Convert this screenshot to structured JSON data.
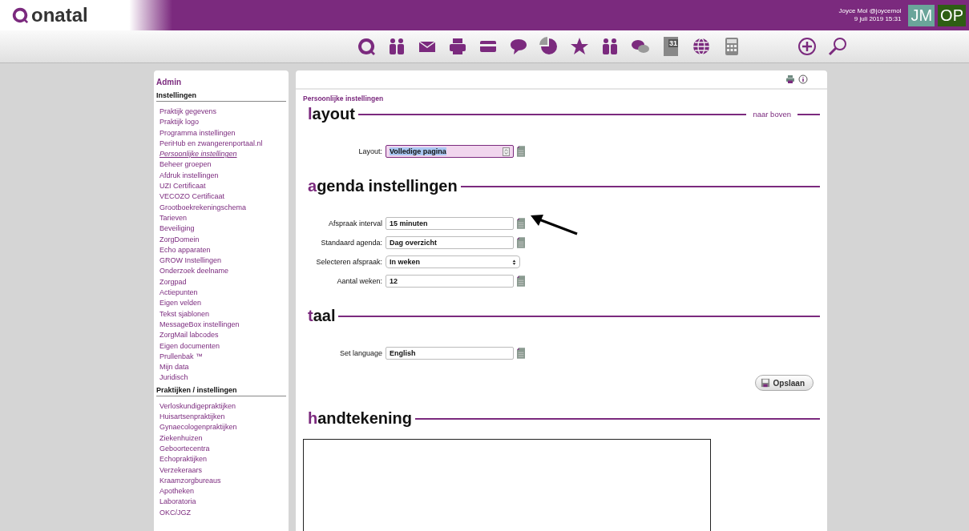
{
  "header": {
    "logo": "onatal",
    "user": "Joyce Mol @joycemol",
    "datetime": "9 juli 2019 15:31",
    "avatars": [
      {
        "initials": "JM",
        "color": "#6aa59a"
      },
      {
        "initials": "OP",
        "color": "#2e5e14"
      }
    ]
  },
  "toolbar": {
    "calendar_day": "31"
  },
  "sidebar": {
    "title": "Admin",
    "sections": [
      {
        "heading": "Instellingen",
        "items": [
          {
            "label": "Praktijk gegevens",
            "selected": false
          },
          {
            "label": "Praktijk logo",
            "selected": false
          },
          {
            "label": "Programma instellingen",
            "selected": false
          },
          {
            "label": "PeriHub en zwangerenportaal.nl",
            "selected": false
          },
          {
            "label": "Persoonlijke instellingen",
            "selected": true
          },
          {
            "label": "Beheer groepen",
            "selected": false
          },
          {
            "label": "Afdruk instellingen",
            "selected": false
          },
          {
            "label": "UZI Certificaat",
            "selected": false
          },
          {
            "label": "VECOZO Certificaat",
            "selected": false
          },
          {
            "label": "Grootboekrekeningschema",
            "selected": false
          },
          {
            "label": "Tarieven",
            "selected": false
          },
          {
            "label": "Beveiliging",
            "selected": false
          },
          {
            "label": "ZorgDomein",
            "selected": false
          },
          {
            "label": "Echo apparaten",
            "selected": false
          },
          {
            "label": "GROW Instellingen",
            "selected": false
          },
          {
            "label": "Onderzoek deelname",
            "selected": false
          },
          {
            "label": "Zorgpad",
            "selected": false
          },
          {
            "label": "Actiepunten",
            "selected": false
          },
          {
            "label": "Eigen velden",
            "selected": false
          },
          {
            "label": "Tekst sjablonen",
            "selected": false
          },
          {
            "label": "MessageBox instellingen",
            "selected": false
          },
          {
            "label": "ZorgMail labcodes",
            "selected": false
          },
          {
            "label": "Eigen documenten",
            "selected": false
          },
          {
            "label": "Prullenbak ™",
            "selected": false
          },
          {
            "label": "Mijn data",
            "selected": false
          },
          {
            "label": "Juridisch",
            "selected": false
          }
        ]
      },
      {
        "heading": "Praktijken / instellingen",
        "items": [
          {
            "label": "Verloskundigepraktijken",
            "selected": false
          },
          {
            "label": "Huisartsenpraktijken",
            "selected": false
          },
          {
            "label": "Gynaecologenpraktijken",
            "selected": false
          },
          {
            "label": "Ziekenhuizen",
            "selected": false
          },
          {
            "label": "Geboortecentra",
            "selected": false
          },
          {
            "label": "Echopraktijken",
            "selected": false
          },
          {
            "label": "Verzekeraars",
            "selected": false
          },
          {
            "label": "Kraamzorgbureaus",
            "selected": false
          },
          {
            "label": "Apotheken",
            "selected": false
          },
          {
            "label": "Laboratoria",
            "selected": false
          },
          {
            "label": "OKC/JGZ",
            "selected": false
          }
        ]
      }
    ]
  },
  "main": {
    "breadcrumb": "Persoonlijke instellingen",
    "sections": [
      {
        "title": "layout",
        "top_link": "naar boven",
        "fields": [
          {
            "label": "Layout:",
            "kind": "select",
            "value": "Volledige pagina",
            "focused": true
          }
        ]
      },
      {
        "title": "agenda instellingen",
        "fields": [
          {
            "label": "Afspraak interval",
            "kind": "input",
            "value": "15 minuten"
          },
          {
            "label": "Standaard agenda:",
            "kind": "input",
            "value": "Dag overzicht"
          },
          {
            "label": "Selecteren afspraak:",
            "kind": "dropdown",
            "value": "In weken"
          },
          {
            "label": "Aantal weken:",
            "kind": "input",
            "value": "12"
          }
        ]
      },
      {
        "title": "taal",
        "fields": [
          {
            "label": "Set language",
            "kind": "input",
            "value": "English"
          }
        ],
        "save_button": "Opslaan"
      },
      {
        "title": "handtekening",
        "kind": "signature"
      }
    ]
  }
}
